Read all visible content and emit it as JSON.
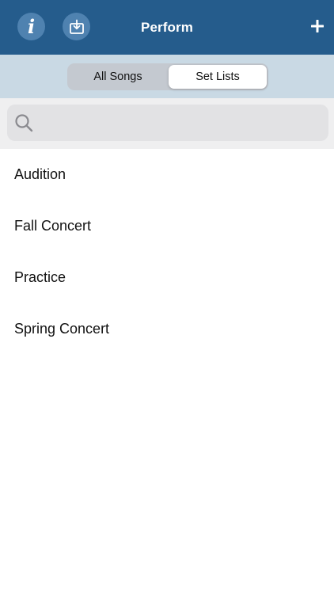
{
  "navbar": {
    "title": "Perform",
    "background": "#255c8c",
    "buttons": [
      {
        "icon": "info-icon",
        "glyph": "i"
      },
      {
        "icon": "import-download-icon"
      },
      {
        "icon": "plus-icon"
      }
    ]
  },
  "segments": {
    "all_songs": "All Songs",
    "set_lists": "Set Lists",
    "selected": "Set Lists"
  },
  "search": {
    "value": "",
    "icon": "search-icon"
  },
  "set_lists": [
    "Audition",
    "Fall Concert",
    "Practice",
    "Spring Concert"
  ]
}
